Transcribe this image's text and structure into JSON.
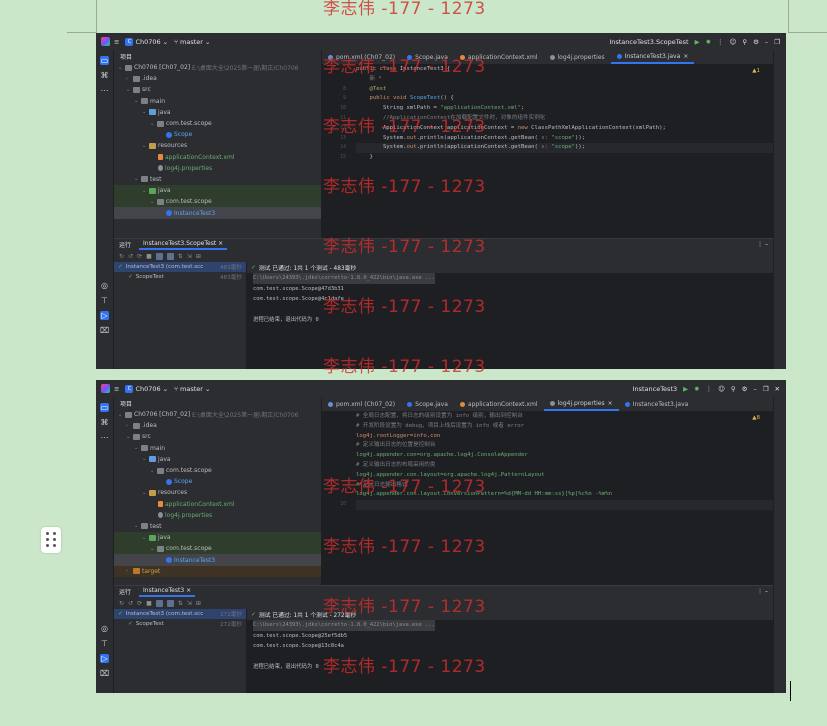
{
  "watermark": "李志伟 -177 - 1273",
  "top": {
    "project_badge": "C",
    "project_name": "Ch0706",
    "branch": "master",
    "run_config": "InstanceTest3.ScopeTest",
    "panel_title": "项目",
    "tree": [
      {
        "label": "Ch0706 [Ch07_02]",
        "extra": "E:\\桌面大全\\2025第一届\\期正/Ch0706",
        "icon": "dir",
        "level": 0
      },
      {
        "label": ".idea",
        "icon": "dir",
        "level": 1
      },
      {
        "label": "src",
        "icon": "dir",
        "level": 1
      },
      {
        "label": "main",
        "icon": "dir",
        "level": 2
      },
      {
        "label": "java",
        "icon": "src",
        "level": 3
      },
      {
        "label": "com.test.scope",
        "icon": "dir",
        "level": 4
      },
      {
        "label": "Scope",
        "icon": "class",
        "level": 5
      },
      {
        "label": "resources",
        "icon": "res",
        "level": 3
      },
      {
        "label": "applicationContext.xml",
        "icon": "xml",
        "level": 4
      },
      {
        "label": "log4j.properties",
        "icon": "prop",
        "level": 4
      },
      {
        "label": "test",
        "icon": "dir",
        "level": 2
      },
      {
        "label": "java",
        "icon": "test",
        "level": 3
      },
      {
        "label": "com.test.scope",
        "icon": "dir",
        "level": 4
      },
      {
        "label": "InstanceTest3",
        "icon": "class",
        "level": 5
      }
    ],
    "tabs": [
      "pom.xml (Ch07_02)",
      "Scope.java",
      "applicationContext.xml",
      "log4j.properties",
      "InstanceTest3.java"
    ],
    "active_tab": 4,
    "warning_count": "▲1",
    "code": [
      {
        "n": "",
        "t": "public class InstanceTest3 {"
      },
      {
        "n": "",
        "t": "    新 *"
      },
      {
        "n": "8",
        "t": "    @Test"
      },
      {
        "n": "9",
        "t": "    public void ScopeTest() {"
      },
      {
        "n": "10",
        "t": "        String xmlPath = \"applicationContext.xml\";"
      },
      {
        "n": "11",
        "t": "        //ApplicationContext在加载配置文件时，对象的组件实例化"
      },
      {
        "n": "12",
        "t": "        ApplicationContext applicationContext = new ClassPathXmlApplicationContext(xmlPath);"
      },
      {
        "n": "13",
        "t": "        System.out.println(applicationContext.getBean( s: \"scope\"));"
      },
      {
        "n": "14",
        "t": "        System.out.println(applicationContext.getBean( s: \"scope\"));"
      },
      {
        "n": "15",
        "t": "    }"
      }
    ],
    "run_label": "运行",
    "run_tab": "InstanceTest3.ScopeTest",
    "status": "测试 已通过: 1共 1 个测试 - 483毫秒",
    "results": [
      {
        "label": "InstanceTest3 (com.test.scc",
        "time": "483毫秒"
      },
      {
        "label": "ScopeTest",
        "time": "483毫秒"
      }
    ],
    "console": [
      "C:\\Users\\24393\\.jdks\\corretto-1.8.0_422\\bin\\java.exe ...",
      "com.test.scope.Scope@47d3b31",
      "com.test.scope.Scope@4c1dafe",
      "",
      "进程已结束，退出代码为 0"
    ]
  },
  "bottom": {
    "project_badge": "C",
    "project_name": "Ch0706",
    "branch": "master",
    "run_config": "InstanceTest3",
    "panel_title": "项目",
    "tree": [
      {
        "label": "Ch0706 [Ch07_02]",
        "extra": "E:\\桌面大全\\2025第一届\\期正/Ch0706",
        "icon": "dir",
        "level": 0
      },
      {
        "label": ".idea",
        "icon": "dir",
        "level": 1
      },
      {
        "label": "src",
        "icon": "dir",
        "level": 1
      },
      {
        "label": "main",
        "icon": "dir",
        "level": 2
      },
      {
        "label": "java",
        "icon": "src",
        "level": 3
      },
      {
        "label": "com.test.scope",
        "icon": "dir",
        "level": 4
      },
      {
        "label": "Scope",
        "icon": "class",
        "level": 5
      },
      {
        "label": "resources",
        "icon": "res",
        "level": 3
      },
      {
        "label": "applicationContext.xml",
        "icon": "xml",
        "level": 4
      },
      {
        "label": "log4j.properties",
        "icon": "prop",
        "level": 4
      },
      {
        "label": "test",
        "icon": "dir",
        "level": 2
      },
      {
        "label": "java",
        "icon": "test",
        "level": 3
      },
      {
        "label": "com.test.scope",
        "icon": "dir",
        "level": 4
      },
      {
        "label": "InstanceTest3",
        "icon": "class",
        "level": 5
      },
      {
        "label": "target",
        "icon": "tgt",
        "level": 1
      }
    ],
    "tabs": [
      "pom.xml (Ch07_02)",
      "Scope.java",
      "applicationContext.xml",
      "log4j.properties",
      "InstanceTest3.java"
    ],
    "active_tab": 3,
    "warning_count": "▲8",
    "code": [
      {
        "n": "",
        "t": "# 全局日志配置，将日志的级别设置为 info 级别，输出到控制台"
      },
      {
        "n": "",
        "t": "# 开发阶段设置为 debug，项目上线后设置为 info 或者 error"
      },
      {
        "n": "",
        "t": "log4j.rootLogger=info,con"
      },
      {
        "n": "",
        "t": "# 定义输出日志的位置是控制台"
      },
      {
        "n": "",
        "t": "log4j.appender.con=org.apache.log4j.ConsoleAppender"
      },
      {
        "n": "",
        "t": "# 定义输出日志的布局采用的类"
      },
      {
        "n": "",
        "t": "log4j.appender.con.layout=org.apache.log4j.PatternLayout"
      },
      {
        "n": "",
        "t": "# 定义日志输出格式"
      },
      {
        "n": "",
        "t": "log4j.appender.con.layout.ConversionPattern=%d{MM-dd HH:mm:ss}[%p]%c%n -%m%n"
      },
      {
        "n": "10",
        "t": ""
      }
    ],
    "run_label": "运行",
    "run_tab": "InstanceTest3",
    "status": "测试 已通过: 1共 1 个测试 - 272毫秒",
    "results": [
      {
        "label": "InstanceTest3 (com.test.scc",
        "time": "272毫秒"
      },
      {
        "label": "ScopeTest",
        "time": "272毫秒"
      }
    ],
    "console": [
      "C:\\Users\\24393\\.jdks\\corretto-1.8.0_422\\bin\\java.exe ...",
      "com.test.scope.Scope@25ef5db5",
      "com.test.scope.Scope@13c8c4a",
      "",
      "进程已结束，退出代码为 0"
    ]
  }
}
